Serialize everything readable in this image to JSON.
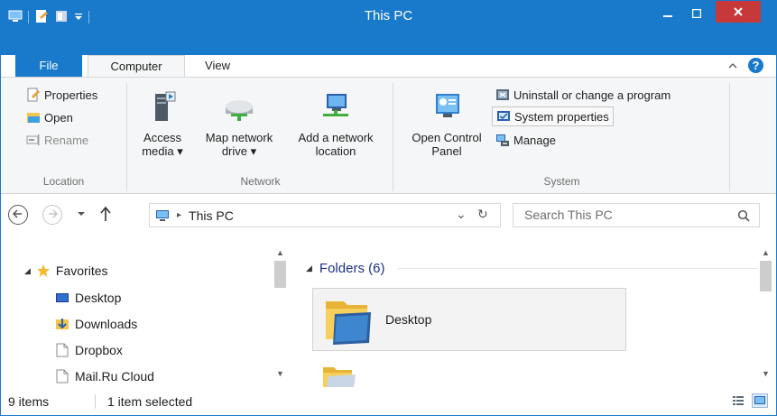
{
  "window": {
    "title": "This PC",
    "minimize_glyph": "‒",
    "maximize_glyph": "□",
    "close_glyph": "✕"
  },
  "colors": {
    "accent": "#1979ca",
    "close": "#c73838",
    "folder": "#f3c54a",
    "header_text": "#1e3287"
  },
  "tabs": [
    {
      "label": "File"
    },
    {
      "label": "Computer"
    },
    {
      "label": "View"
    }
  ],
  "ribbon": {
    "location": {
      "label": "Location",
      "properties": "Properties",
      "open": "Open",
      "rename": "Rename"
    },
    "network": {
      "label": "Network",
      "access_media_line1": "Access",
      "access_media_line2": "media ▾",
      "map_drive_line1": "Map network",
      "map_drive_line2": "drive ▾",
      "add_location_line1": "Add a network",
      "add_location_line2": "location"
    },
    "system": {
      "label": "System",
      "open_cp_line1": "Open Control",
      "open_cp_line2": "Panel",
      "uninstall": "Uninstall or change a program",
      "system_properties": "System properties",
      "manage": "Manage"
    }
  },
  "address": {
    "path": "This PC",
    "dropdown": "⌄",
    "refresh": "↻",
    "search_placeholder": "Search This PC"
  },
  "navigation": {
    "favorites": "Favorites",
    "items": [
      {
        "label": "Desktop"
      },
      {
        "label": "Downloads"
      },
      {
        "label": "Dropbox"
      },
      {
        "label": "Mail.Ru Cloud"
      }
    ]
  },
  "content": {
    "group_header": "Folders (6)",
    "tiles": [
      {
        "label": "Desktop"
      }
    ]
  },
  "status": {
    "items": "9 items",
    "selected": "1 item selected"
  }
}
